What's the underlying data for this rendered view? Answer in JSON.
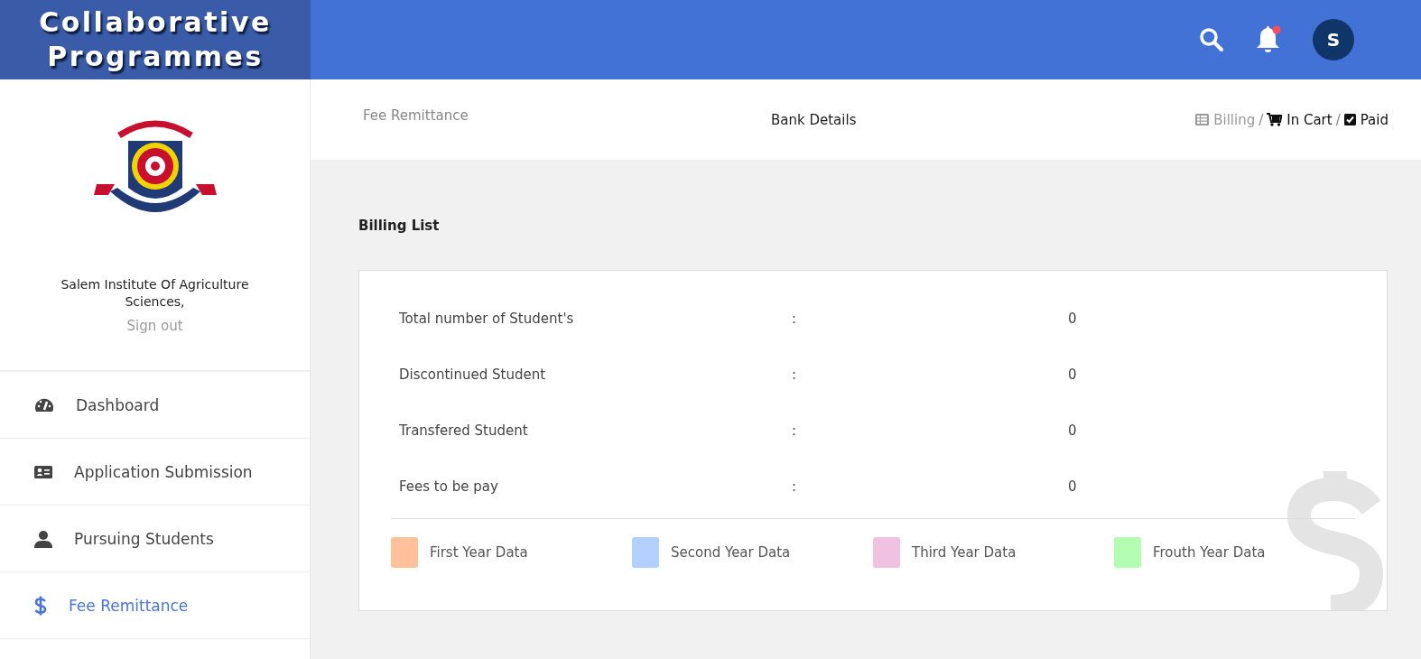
{
  "brand": {
    "title": "Collaborative Programmes"
  },
  "header": {
    "avatar_letter": "S",
    "notification_unread": true
  },
  "sidebar": {
    "institution": "Salem Institute Of Agriculture Sciences,",
    "sign_out": "Sign out",
    "items": [
      {
        "label": "Dashboard",
        "kind": "gauge",
        "selected": false
      },
      {
        "label": "Application Submission",
        "kind": "idcard",
        "selected": false
      },
      {
        "label": "Pursuing Students",
        "kind": "user",
        "selected": false
      },
      {
        "label": "Fee Remittance",
        "kind": "dollar",
        "selected": true
      }
    ]
  },
  "subnav": {
    "page_title": "Fee Remittance",
    "bank_details": "Bank Details",
    "breadcrumbs": [
      {
        "label": "Billing",
        "kind": "list",
        "muted": true
      },
      {
        "separator": "/",
        "label": "In Cart",
        "kind": "cart",
        "muted": false
      },
      {
        "separator": "/",
        "label": "Paid",
        "kind": "check",
        "muted": false
      }
    ]
  },
  "billing": {
    "title": "Billing List",
    "rows": [
      {
        "label": "Total number of Student's",
        "separator": ":",
        "value": "0"
      },
      {
        "label": "Discontinued Student",
        "separator": ":",
        "value": "0"
      },
      {
        "label": "Transfered Student",
        "separator": ":",
        "value": "0"
      },
      {
        "label": "Fees to be pay",
        "separator": ":",
        "value": "0"
      }
    ],
    "legend": [
      {
        "label": "First Year Data",
        "color": "#ffc09a"
      },
      {
        "label": "Second Year Data",
        "color": "#b3d0fd"
      },
      {
        "label": "Third Year Data",
        "color": "#f0c2e0"
      },
      {
        "label": "Frouth Year Data",
        "color": "#b3fdb3"
      }
    ]
  }
}
